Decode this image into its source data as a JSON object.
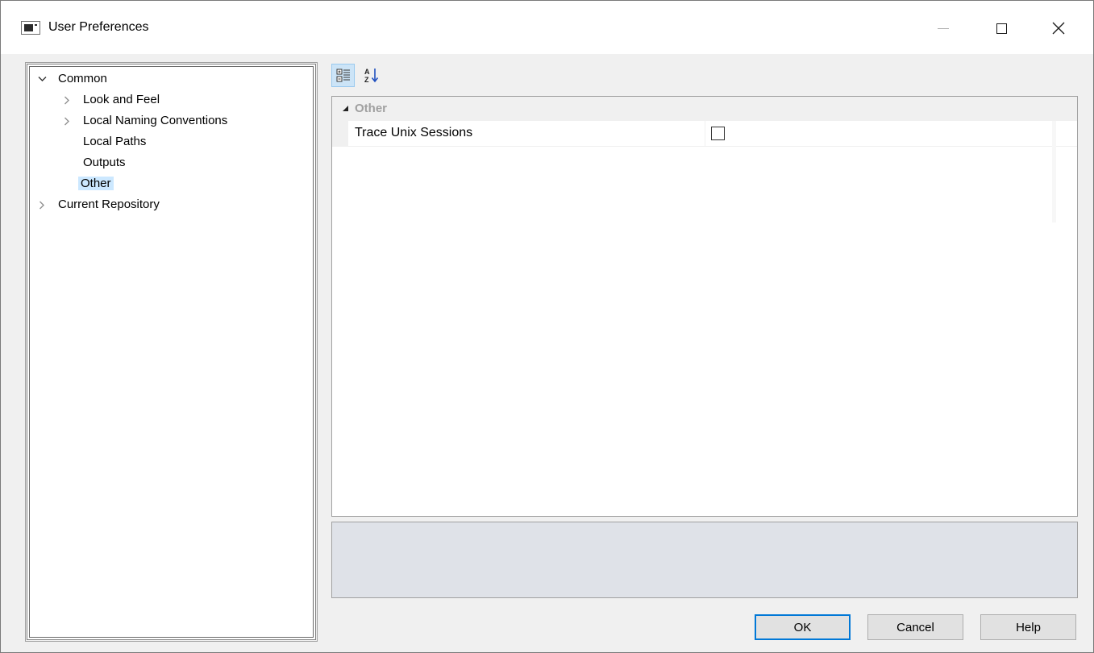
{
  "window": {
    "title": "User Preferences",
    "icon": "window-app-icon",
    "controls": [
      "minimize-icon",
      "maximize-icon",
      "close-icon"
    ]
  },
  "tree": {
    "items": [
      {
        "label": "Common",
        "expanded": true,
        "level": 0
      },
      {
        "label": "Look and Feel",
        "expanded": false,
        "level": 1
      },
      {
        "label": "Local Naming Conventions",
        "expanded": false,
        "level": 1
      },
      {
        "label": "Local Paths",
        "level": 1
      },
      {
        "label": "Outputs",
        "level": 1
      },
      {
        "label": "Other",
        "level": 1,
        "selected": true
      },
      {
        "label": "Current Repository",
        "expanded": false,
        "level": 0
      }
    ]
  },
  "toolbar": {
    "categorized_icon": "categorized-view-icon",
    "alphabetical_icon": "sort-alphabetical-icon",
    "categorized_active": true
  },
  "property_grid": {
    "category": "Other",
    "properties": [
      {
        "name": "Trace Unix Sessions",
        "checked": false
      }
    ]
  },
  "buttons": {
    "ok": "OK",
    "cancel": "Cancel",
    "help": "Help"
  },
  "colors": {
    "selection": "#cce8ff",
    "accent": "#0078d7",
    "description_panel": "#dfe2e8"
  }
}
